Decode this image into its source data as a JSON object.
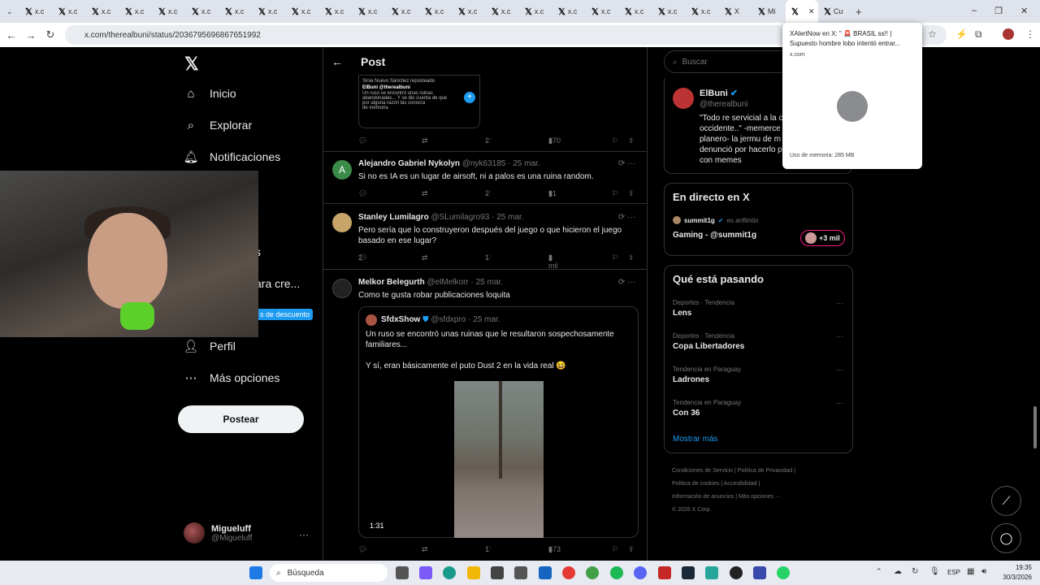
{
  "browser": {
    "tabs": [
      {
        "label": "x.c"
      },
      {
        "label": "x.c"
      },
      {
        "label": "x.c"
      },
      {
        "label": "x.c"
      },
      {
        "label": "x.c"
      },
      {
        "label": "x.c"
      },
      {
        "label": "x.c"
      },
      {
        "label": "x.c"
      },
      {
        "label": "x.c"
      },
      {
        "label": "x.c"
      },
      {
        "label": "x.c"
      },
      {
        "label": "x.c"
      },
      {
        "label": "x.c"
      },
      {
        "label": "x.c"
      },
      {
        "label": "x.c"
      },
      {
        "label": "x.c"
      },
      {
        "label": "x.c"
      },
      {
        "label": "x.c"
      },
      {
        "label": "x.c"
      },
      {
        "label": "x.c"
      },
      {
        "label": "x.c"
      },
      {
        "label": "X"
      },
      {
        "label": "Mi"
      },
      {
        "label": ""
      },
      {
        "label": "Cu"
      }
    ],
    "url": "x.com/therealbuni/status/2036795696867651992"
  },
  "popup": {
    "title": "XAlertNow en X: \" 🚨 BRASIL ss!! | Supuesto hombre lobo intentó entrar...",
    "domain": "x.com",
    "memory": "Uso de memoria: 285 MB"
  },
  "nav": {
    "home": "Inicio",
    "explore": "Explorar",
    "notifications": "Notificaciones",
    "partial1": "s",
    "partial2": "ara cre...",
    "discount": "s de descuento",
    "profile": "Perfil",
    "more": "Más opciones",
    "post_button": "Postear",
    "user_name": "Migueluff",
    "user_handle": "@Migueluff"
  },
  "header": {
    "title": "Post"
  },
  "thumb": {
    "line1": "Sinia Nuevo Sánchez reposteado",
    "line2": "ElBuni @therealbuni",
    "line3": "Un ruso se encontró unas ruinas abandonadas... Y se dio cuenta de que por alguna razón las conocía",
    "line4": "de memoria"
  },
  "first_actions": {
    "likes": "2",
    "views": "370"
  },
  "replies": [
    {
      "name": "Alejandro Gabriel Nykolyn",
      "handle": "@nyk63185 · 25 mar.",
      "text": "Si no es IA es un lugar de airsoft, ni a palos es una ruina random.",
      "replies": "",
      "likes": "2",
      "views": "91",
      "initial": "A"
    },
    {
      "name": "Stanley Lumilagro",
      "handle": "@SLumilagro93 · 25 mar.",
      "text": "Pero sería que lo construyeron después del juego o que hicieron el juego basado en ese lugar?",
      "replies": "2",
      "likes": "1",
      "views": "3 mil"
    },
    {
      "name": "Melkor Belegurth",
      "handle": "@elMelkorr · 25 mar.",
      "text": "Como te gusta robar publicaciones loquita",
      "likes": "1",
      "views": "673"
    }
  ],
  "quote": {
    "name": "SfdxShow",
    "handle": "@sfdxpro · 25 mar.",
    "text1": "Un ruso se encontró unas ruinas que le resultaron sospechosamente familiares...",
    "text2": "Y sí, eran básicamente el puto Dust 2 en la vida real 😆",
    "duration": "1:31"
  },
  "right": {
    "search_placeholder": "Buscar",
    "profile_name": "ElBuni",
    "profile_handle": "@therealbuni",
    "profile_bio": "\"Todo re servicial a la c occidente..\" -memerce planero- la jermu de m denunció por hacerlo p con memes",
    "live_title": "En directo en X",
    "live_host": "summit1g",
    "live_role": "es anfitrión",
    "live_stream": "Gaming - @summit1g",
    "live_count": "+3 mil",
    "trends_title": "Qué está pasando",
    "trends": [
      {
        "cat": "Deportes · Tendencia",
        "name": "Lens"
      },
      {
        "cat": "Deportes · Tendencia",
        "name": "Copa Libertadores"
      },
      {
        "cat": "Tendencia en Paraguay",
        "name": "Ladrones"
      },
      {
        "cat": "Tendencia en Paraguay",
        "name": "Con 36"
      }
    ],
    "show_more": "Mostrar más",
    "footer1": "Condiciones de Servicio  |  Política de Privacidad  |",
    "footer2": "Política de cookies  |  Accesibilidad  |",
    "footer3": "Información de anuncios  |  Más opciones ···",
    "footer4": "© 2026 X Corp."
  },
  "taskbar": {
    "search": "Búsqueda",
    "lang": "ESP",
    "time": "19:35",
    "date": "30/3/2026"
  }
}
